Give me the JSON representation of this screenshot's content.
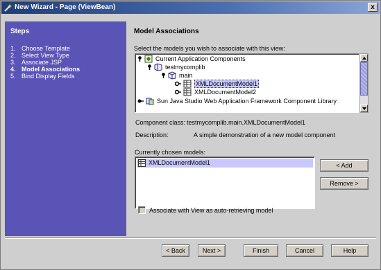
{
  "window": {
    "title": "New Wizard - Page (ViewBean)",
    "close_label": "x"
  },
  "steps": {
    "title": "Steps",
    "items": [
      {
        "num": "1.",
        "label": "Choose Template"
      },
      {
        "num": "2.",
        "label": "Select View Type"
      },
      {
        "num": "3.",
        "label": "Associate JSP"
      },
      {
        "num": "4.",
        "label": "Model Associations"
      },
      {
        "num": "5.",
        "label": "Bind Display Fields"
      }
    ]
  },
  "main": {
    "header": "Model Associations",
    "select_prompt": "Select the models you wish to associate with this view:",
    "tree": [
      {
        "label": "Current Application Components"
      },
      {
        "label": "testmycomplib"
      },
      {
        "label": "main"
      },
      {
        "label": "XMLDocumentModel1"
      },
      {
        "label": "XMLDocumentModel2"
      },
      {
        "label": "Sun Java Studio Web Application Framework Component Library"
      }
    ],
    "component_class_label": "Component class:",
    "component_class_value": "testmycomplib.main.XMLDocumentModel1",
    "description_label": "Description:",
    "description_value": "A simple demonstration of a new model component",
    "chosen_label": "Currently chosen models:",
    "chosen_items": [
      "XMLDocumentModel1"
    ],
    "add_label": "< Add",
    "remove_label": "Remove >",
    "assoc_label": "Associate with View as auto-retrieving model",
    "assoc_checked": false
  },
  "buttons": {
    "back": "< Back",
    "next": "Next >",
    "finish": "Finish",
    "cancel": "Cancel",
    "help": "Help"
  },
  "colors": {
    "steps_panel": "#5b54b7",
    "selection": "#c8c8ff",
    "title_bar": "#1e3d7a"
  }
}
